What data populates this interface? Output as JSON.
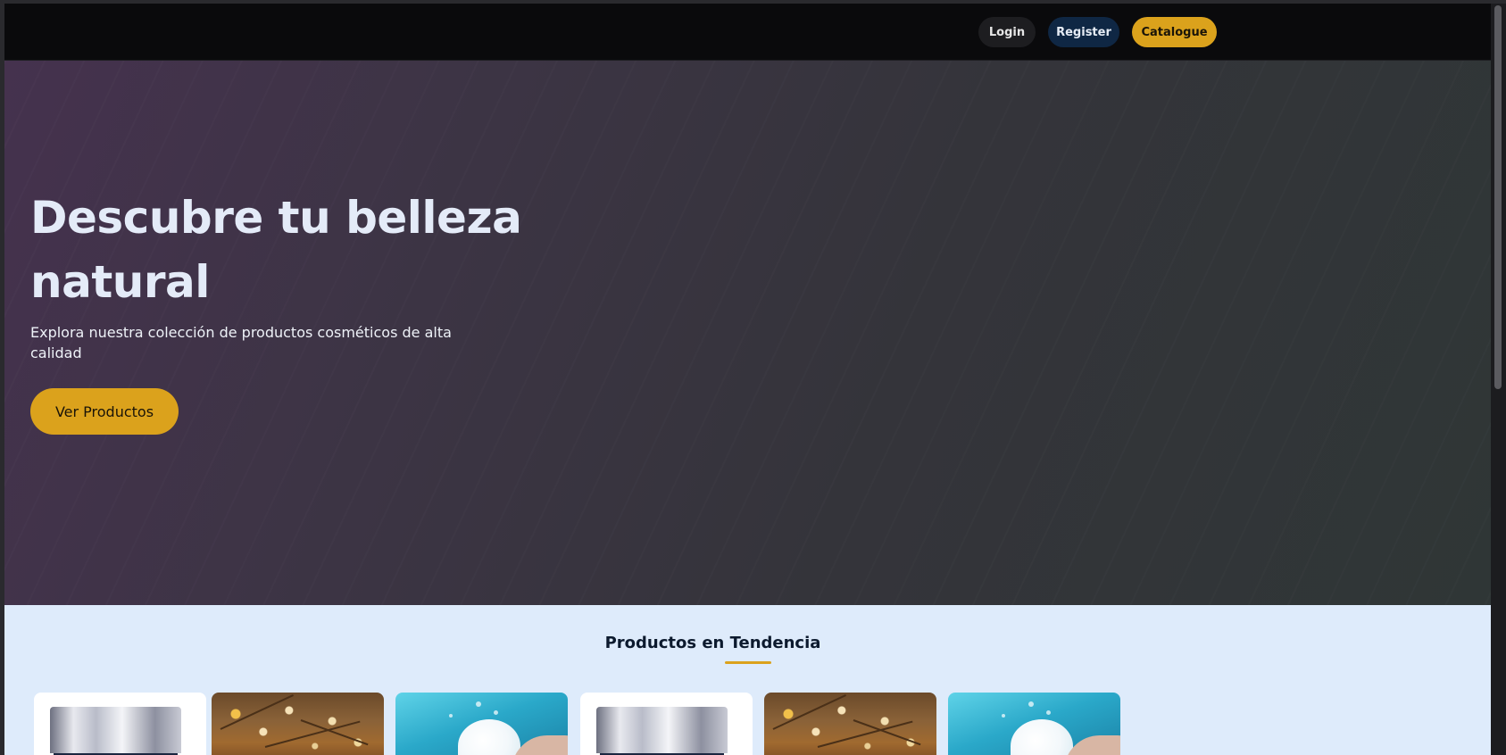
{
  "nav": {
    "login_label": "Login",
    "register_label": "Register",
    "catalogue_label": "Catalogue"
  },
  "hero": {
    "title": "Descubre tu belleza natural",
    "subtitle": "Explora nuestra colección de productos cosméticos de alta calidad",
    "cta_label": "Ver Productos"
  },
  "trending": {
    "title": "Productos en Tendencia",
    "products": [
      {
        "image": "cream-jar-image"
      },
      {
        "image": "dried-flowers-image"
      },
      {
        "image": "cream-splash-image"
      },
      {
        "image": "cream-jar-image"
      },
      {
        "image": "dried-flowers-image"
      },
      {
        "image": "cream-splash-image"
      }
    ]
  },
  "colors": {
    "accent": "#dba21c",
    "navbar_bg": "#0a0a0c",
    "register_bg": "#0f2744",
    "section_bg": "#deebfb",
    "hero_text": "#e4ebf8"
  }
}
